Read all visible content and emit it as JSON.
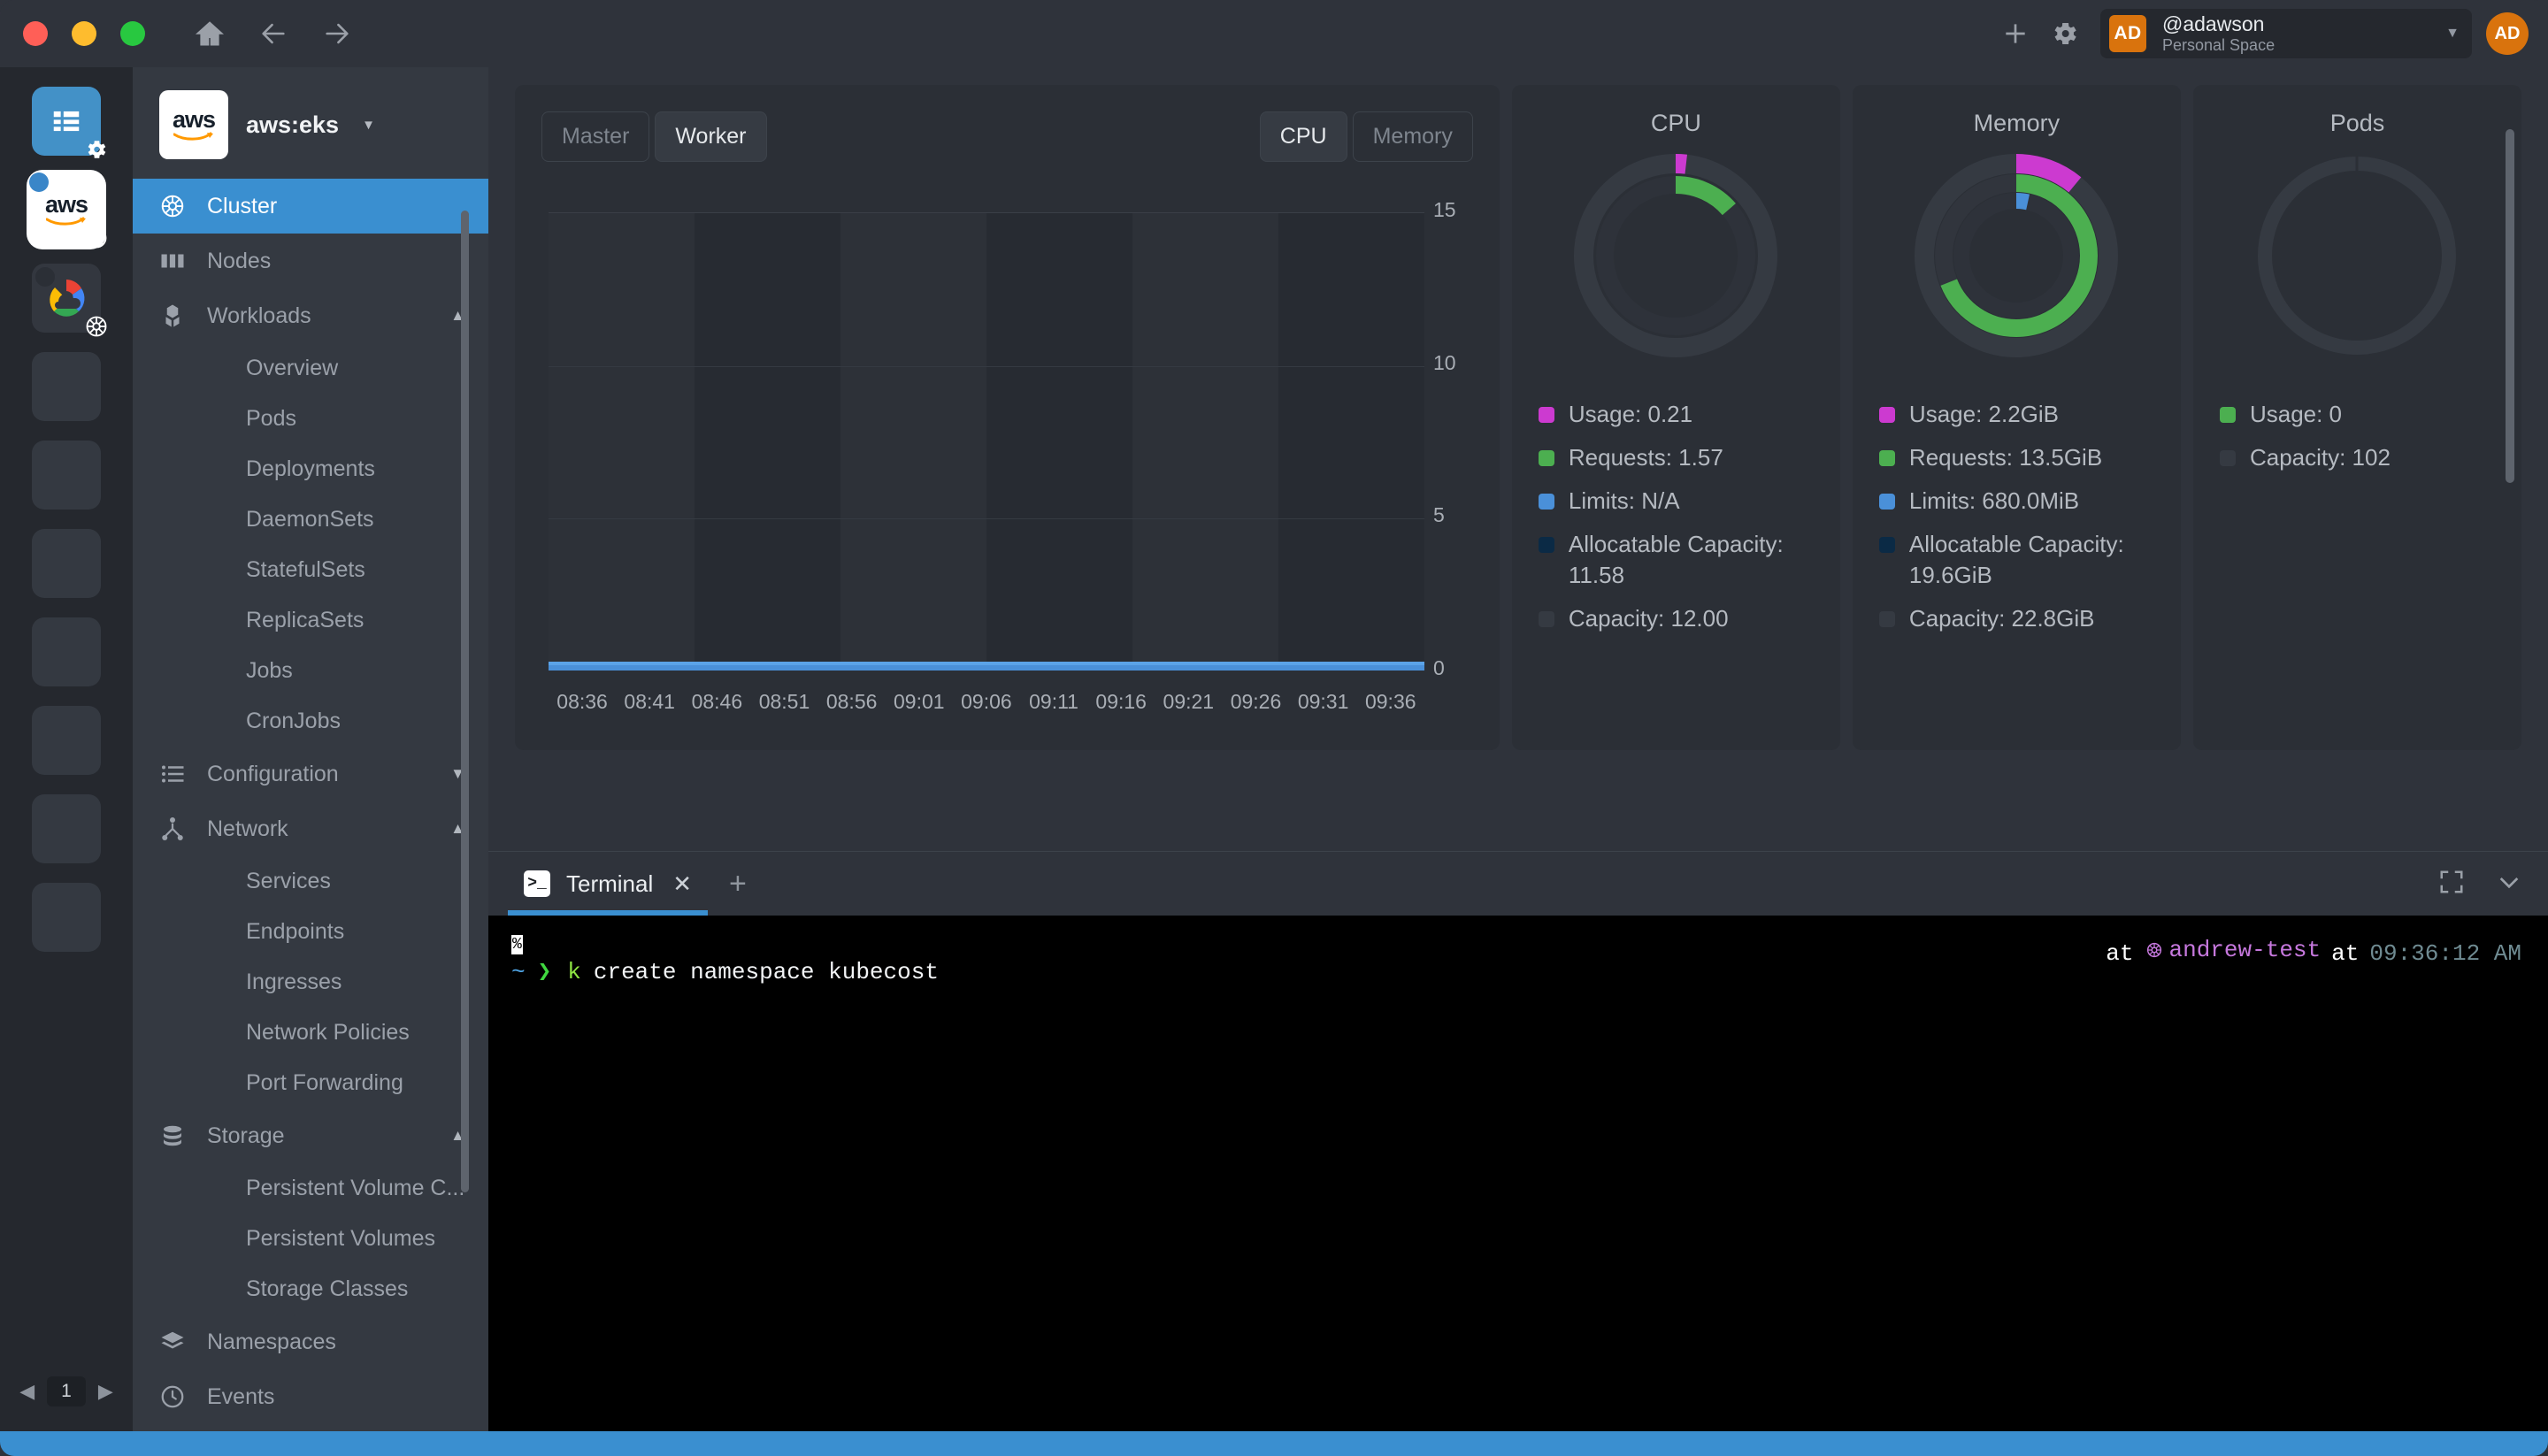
{
  "titlebar": {
    "nav": {
      "home": "home-icon",
      "back": "back-arrow-icon",
      "forward": "forward-arrow-icon"
    },
    "actions": {
      "add": "plus-icon",
      "settings": "gear-icon"
    },
    "account": {
      "avatar_initials": "AD",
      "username": "@adawson",
      "space": "Personal Space",
      "caret": "▼",
      "profile_initials": "AD"
    }
  },
  "rail": {
    "items": [
      {
        "name": "dashboard-tile",
        "badge": "gear-icon"
      },
      {
        "name": "aws-cluster-tile",
        "label": "aws",
        "badge": "kubernetes-icon"
      },
      {
        "name": "gcp-cluster-tile",
        "badge": "kubernetes-icon"
      },
      {
        "name": "empty-slot"
      },
      {
        "name": "empty-slot"
      },
      {
        "name": "empty-slot"
      },
      {
        "name": "empty-slot"
      },
      {
        "name": "empty-slot"
      },
      {
        "name": "empty-slot"
      },
      {
        "name": "empty-slot"
      }
    ],
    "pager": {
      "prev": "◀",
      "page": "1",
      "next": "▶"
    }
  },
  "sidebar": {
    "cluster_logo": "aws",
    "cluster_name": "aws:eks",
    "caret": "▼",
    "nav": [
      {
        "label": "Cluster",
        "icon": "kubernetes-icon",
        "active": true,
        "type": "item"
      },
      {
        "label": "Nodes",
        "icon": "nodes-icon",
        "type": "item"
      },
      {
        "label": "Workloads",
        "icon": "workloads-icon",
        "type": "group",
        "chevron": "▲"
      },
      {
        "label": "Overview",
        "type": "sub"
      },
      {
        "label": "Pods",
        "type": "sub"
      },
      {
        "label": "Deployments",
        "type": "sub"
      },
      {
        "label": "DaemonSets",
        "type": "sub"
      },
      {
        "label": "StatefulSets",
        "type": "sub"
      },
      {
        "label": "ReplicaSets",
        "type": "sub"
      },
      {
        "label": "Jobs",
        "type": "sub"
      },
      {
        "label": "CronJobs",
        "type": "sub"
      },
      {
        "label": "Configuration",
        "icon": "list-icon",
        "type": "group",
        "chevron": "▼"
      },
      {
        "label": "Network",
        "icon": "network-icon",
        "type": "group",
        "chevron": "▲"
      },
      {
        "label": "Services",
        "type": "sub"
      },
      {
        "label": "Endpoints",
        "type": "sub"
      },
      {
        "label": "Ingresses",
        "type": "sub"
      },
      {
        "label": "Network Policies",
        "type": "sub"
      },
      {
        "label": "Port Forwarding",
        "type": "sub"
      },
      {
        "label": "Storage",
        "icon": "database-icon",
        "type": "group",
        "chevron": "▲"
      },
      {
        "label": "Persistent Volume C...",
        "type": "sub"
      },
      {
        "label": "Persistent Volumes",
        "type": "sub"
      },
      {
        "label": "Storage Classes",
        "type": "sub"
      },
      {
        "label": "Namespaces",
        "icon": "layers-icon",
        "type": "item"
      },
      {
        "label": "Events",
        "icon": "clock-icon",
        "type": "item"
      }
    ]
  },
  "dashboard": {
    "node_filter": {
      "master": "Master",
      "worker": "Worker",
      "selected": "Worker"
    },
    "resource_filter": {
      "cpu": "CPU",
      "memory": "Memory",
      "selected": "CPU"
    },
    "metrics": [
      {
        "title": "CPU",
        "legend": [
          {
            "label": "Usage: 0.21",
            "color": "#cc3ad0"
          },
          {
            "label": "Requests: 1.57",
            "color": "#4caf50"
          },
          {
            "label": "Limits: N/A",
            "color": "#4a90d9"
          },
          {
            "label": "Allocatable Capacity: 11.58",
            "color": "#0b2a45"
          },
          {
            "label": "Capacity: 12.00",
            "color": "#353a42"
          }
        ]
      },
      {
        "title": "Memory",
        "legend": [
          {
            "label": "Usage: 2.2GiB",
            "color": "#cc3ad0"
          },
          {
            "label": "Requests: 13.5GiB",
            "color": "#4caf50"
          },
          {
            "label": "Limits: 680.0MiB",
            "color": "#4a90d9"
          },
          {
            "label": "Allocatable Capacity: 19.6GiB",
            "color": "#0b2a45"
          },
          {
            "label": "Capacity: 22.8GiB",
            "color": "#353a42"
          }
        ]
      },
      {
        "title": "Pods",
        "legend": [
          {
            "label": "Usage: 0",
            "color": "#4caf50"
          },
          {
            "label": "Capacity: 102",
            "color": "#353a42"
          }
        ]
      }
    ]
  },
  "chart_data": {
    "type": "line",
    "title": "",
    "xlabel": "",
    "ylabel": "",
    "ylim": [
      0,
      15
    ],
    "yticks": [
      0,
      5,
      10,
      15
    ],
    "grid": true,
    "x": [
      "08:36",
      "08:41",
      "08:46",
      "08:51",
      "08:56",
      "09:01",
      "09:06",
      "09:11",
      "09:16",
      "09:21",
      "09:26",
      "09:31",
      "09:36"
    ],
    "series": [
      {
        "name": "Worker CPU",
        "color": "#4a90d9",
        "values": [
          0,
          0,
          0,
          0,
          0,
          0,
          0,
          0,
          0,
          0,
          0,
          0,
          0
        ]
      }
    ]
  },
  "donuts": {
    "cpu": {
      "rings": [
        {
          "name": "usage",
          "color": "#cc3ad0",
          "fraction": 0.018
        },
        {
          "name": "requests",
          "color": "#4caf50",
          "fraction": 0.136
        }
      ]
    },
    "memory": {
      "rings": [
        {
          "name": "usage",
          "color": "#cc3ad0",
          "fraction": 0.11
        },
        {
          "name": "requests",
          "color": "#4caf50",
          "fraction": 0.69
        },
        {
          "name": "limits",
          "color": "#4a90d9",
          "fraction": 0.034
        }
      ]
    },
    "pods": {
      "rings": [
        {
          "name": "usage",
          "color": "#4caf50",
          "fraction": 0.0
        }
      ]
    }
  },
  "terminal": {
    "tab": {
      "label": "Terminal",
      "icon": "terminal-icon",
      "close": "✕"
    },
    "add_tab": "+",
    "actions": {
      "fullscreen": "expand-icon",
      "collapse": "chevron-down-icon"
    },
    "prompt_marker": "%",
    "prompt_path": "~",
    "prompt_arrow": "❯",
    "command_bin": "k",
    "command_args": "create namespace kubecost",
    "status_at1": "at",
    "context_icon": "kubernetes-icon",
    "context": "andrew-test",
    "status_at2": "at",
    "time": "09:36:12 AM"
  }
}
